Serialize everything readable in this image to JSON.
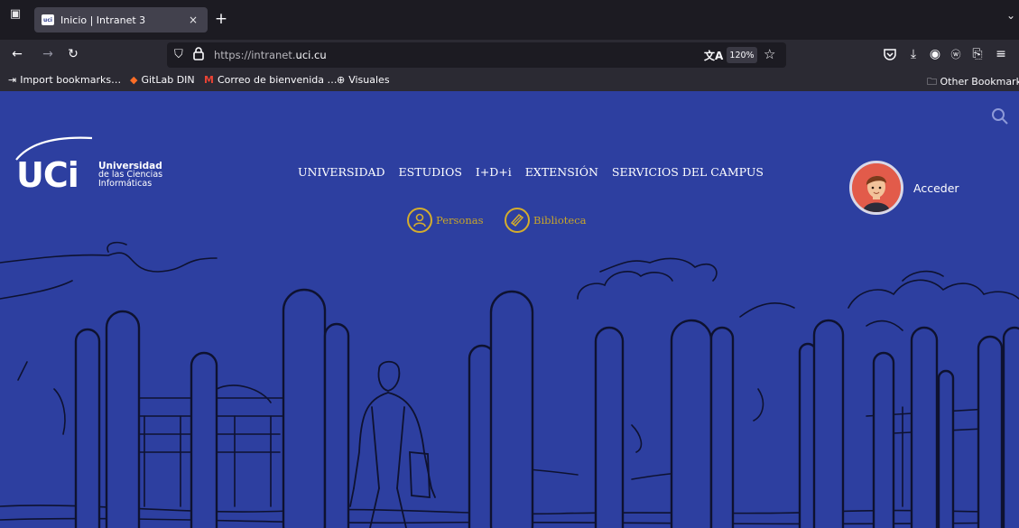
{
  "browser": {
    "tab": {
      "title": "Inicio | Intranet 3",
      "favicon_text": "uci",
      "close_label": "×"
    },
    "new_tab_label": "+",
    "url": {
      "scheme": "https://",
      "subdomain": "intranet.",
      "domain": "uci.cu"
    },
    "zoom": "120%",
    "bookmarks": [
      {
        "label": "Import bookmarks…",
        "icon": "import-icon"
      },
      {
        "label": "GitLab DIN",
        "icon": "gitlab-icon"
      },
      {
        "label": "Correo de bienvenida …",
        "icon": "gmail-icon"
      },
      {
        "label": "Visuales",
        "icon": "globe-icon"
      }
    ],
    "other_bookmarks": "Other Bookmarks"
  },
  "site": {
    "logo": {
      "letters": "UCi",
      "line1": "Universidad",
      "line2": "de las Ciencias",
      "line3": "Informáticas"
    },
    "menu": [
      "UNIVERSIDAD",
      "ESTUDIOS",
      "I+D+i",
      "EXTENSIÓN",
      "SERVICIOS DEL CAMPUS"
    ],
    "quick_links": [
      {
        "label": "Personas",
        "icon": "person-icon"
      },
      {
        "label": "Biblioteca",
        "icon": "book-icon"
      }
    ],
    "login_label": "Acceder",
    "colors": {
      "page_bg": "#2d3fa0",
      "accent": "#d4ad2c",
      "line_art": "#0e1230"
    }
  }
}
